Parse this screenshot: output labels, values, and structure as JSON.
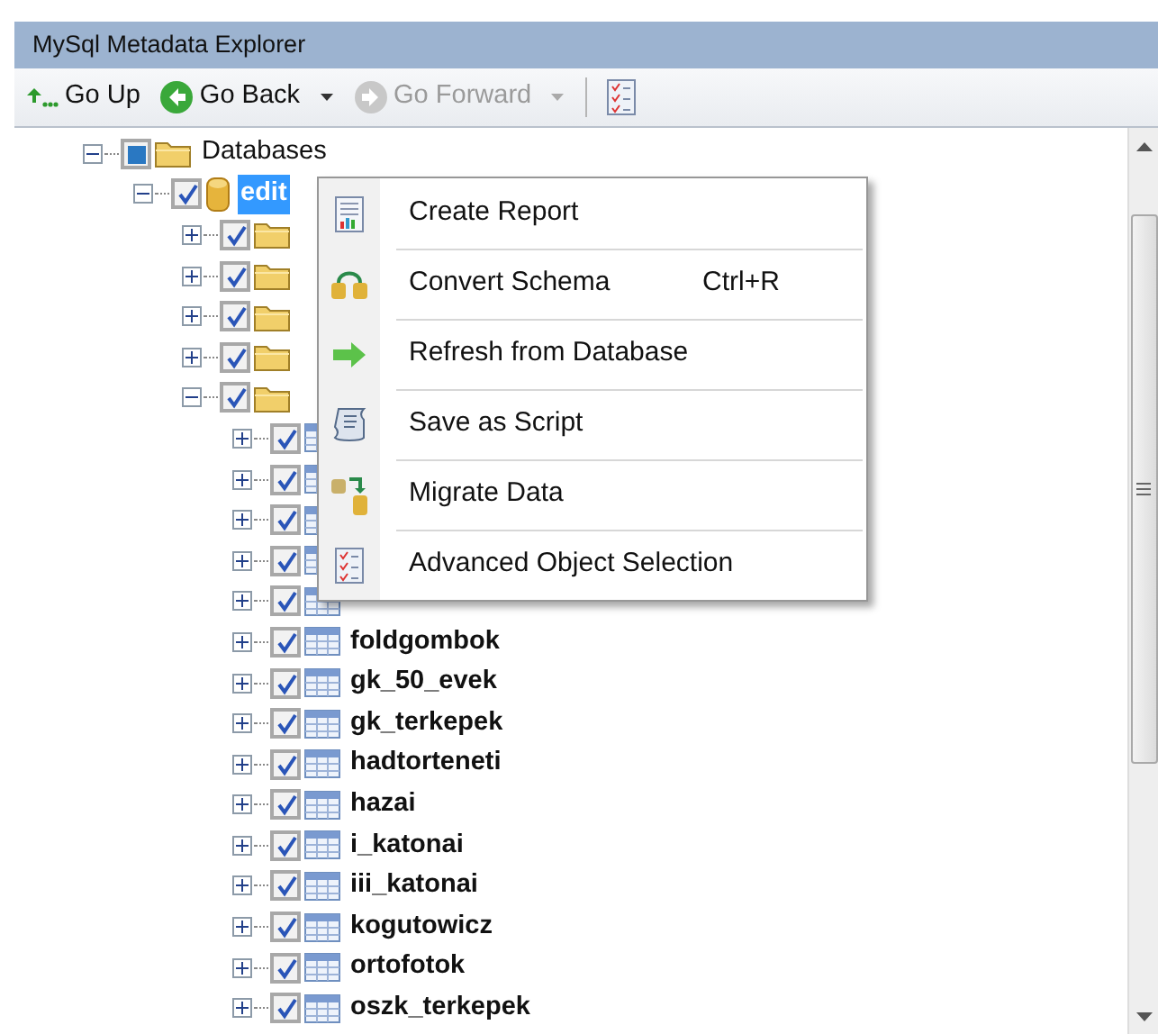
{
  "window": {
    "title": "MySql Metadata Explorer"
  },
  "toolbar": [
    {
      "kind": "button",
      "label": "Go Up",
      "disabled": false
    },
    {
      "kind": "button",
      "label": "Go Back",
      "disabled": false
    },
    {
      "kind": "dropdown",
      "disabled": false
    },
    {
      "kind": "button",
      "label": "Go Forward",
      "disabled": true
    },
    {
      "kind": "dropdown",
      "disabled": true
    },
    {
      "kind": "separator"
    },
    {
      "kind": "icon-button",
      "disabled": false
    }
  ],
  "tree": [
    {
      "kind": "folder",
      "label": "Databases",
      "checked": false,
      "partial": true,
      "expanded": true,
      "selected": false,
      "children": [
        {
          "kind": "database",
          "label": "edit",
          "checked": true,
          "expanded": true,
          "selected": true,
          "children": [
            {
              "kind": "folder",
              "checked": true,
              "expanded": false,
              "selected": false
            },
            {
              "kind": "folder",
              "checked": true,
              "expanded": false,
              "selected": false
            },
            {
              "kind": "folder",
              "checked": true,
              "expanded": false,
              "selected": false
            },
            {
              "kind": "folder",
              "checked": true,
              "expanded": false,
              "selected": false
            },
            {
              "kind": "folder",
              "checked": true,
              "expanded": true,
              "selected": false,
              "children": [
                {
                  "kind": "table",
                  "checked": true,
                  "expanded": false,
                  "selected": false
                },
                {
                  "kind": "table",
                  "checked": true,
                  "expanded": false,
                  "selected": false
                },
                {
                  "kind": "table",
                  "checked": true,
                  "expanded": false,
                  "selected": false
                },
                {
                  "kind": "table",
                  "checked": true,
                  "expanded": false,
                  "selected": false
                },
                {
                  "kind": "table",
                  "checked": true,
                  "expanded": false,
                  "selected": false
                },
                {
                  "kind": "table",
                  "label": "foldgombok",
                  "checked": true,
                  "expanded": false,
                  "selected": false
                },
                {
                  "kind": "table",
                  "label": "gk_50_evek",
                  "checked": true,
                  "expanded": false,
                  "selected": false
                },
                {
                  "kind": "table",
                  "label": "gk_terkepek",
                  "checked": true,
                  "expanded": false,
                  "selected": false
                },
                {
                  "kind": "table",
                  "label": "hadtorteneti",
                  "checked": true,
                  "expanded": false,
                  "selected": false
                },
                {
                  "kind": "table",
                  "label": "hazai",
                  "checked": true,
                  "expanded": false,
                  "selected": false
                },
                {
                  "kind": "table",
                  "label": "i_katonai",
                  "checked": true,
                  "expanded": false,
                  "selected": false
                },
                {
                  "kind": "table",
                  "label": "iii_katonai",
                  "checked": true,
                  "expanded": false,
                  "selected": false
                },
                {
                  "kind": "table",
                  "label": "kogutowicz",
                  "checked": true,
                  "expanded": false,
                  "selected": false
                },
                {
                  "kind": "table",
                  "label": "ortofotok",
                  "checked": true,
                  "expanded": false,
                  "selected": false
                },
                {
                  "kind": "table",
                  "label": "oszk_terkepek",
                  "checked": true,
                  "expanded": false,
                  "selected": false
                }
              ]
            }
          ]
        }
      ]
    }
  ],
  "context_menu": [
    {
      "label": "Create Report"
    },
    {
      "label": "Convert Schema",
      "shortcut": "Ctrl+R"
    },
    {
      "label": "Refresh from Database"
    },
    {
      "label": "Save as Script"
    },
    {
      "label": "Migrate Data"
    },
    {
      "label": "Advanced Object Selection"
    }
  ]
}
